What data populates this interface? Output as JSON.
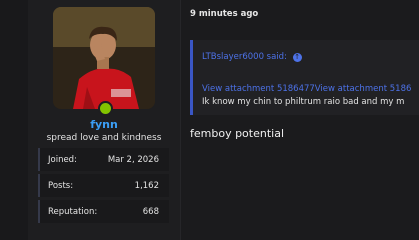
{
  "user": {
    "name": "fynn",
    "title": "spread love and kindness",
    "stats": [
      {
        "label": "Joined:",
        "value": "Mar 2, 2026"
      },
      {
        "label": "Posts:",
        "value": "1,162"
      },
      {
        "label": "Reputation:",
        "value": "668"
      }
    ],
    "online_color": "#83c400"
  },
  "post": {
    "time": "9 minutes ago",
    "quote": {
      "author_said": "LTBslayer6000 said:",
      "attachment": "View attachment 5186477View attachment 5186",
      "text": "Ik know my chin to philtrum raio bad and my m"
    },
    "body": "femboy potential"
  },
  "colors": {
    "accent": "#3b9ef5",
    "quote_bar": "#3a56c5",
    "link": "#4d72e8",
    "background": "#1b1b1d"
  },
  "icons": {
    "quote_jump": "arrow-up-circle-icon"
  }
}
